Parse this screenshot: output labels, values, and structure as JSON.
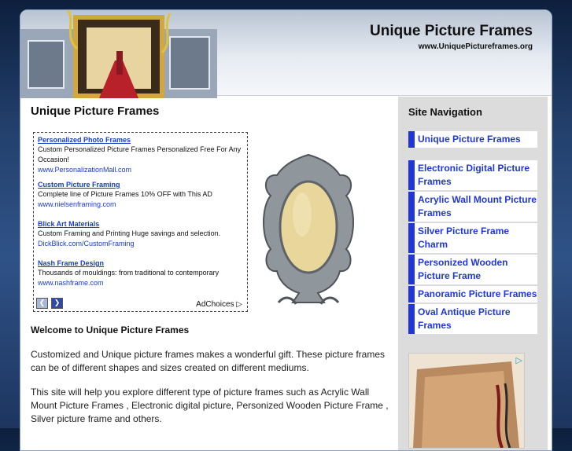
{
  "header": {
    "title": "Unique Picture Frames",
    "url": "www.UniquePictureframes.org"
  },
  "main": {
    "title": "Unique Picture Frames",
    "ads": [
      {
        "title": "Personalized Photo Frames",
        "desc": "Custom Personalized Picture Frames Personalized Free For Any Occasion!",
        "link": "www.PersonalizationMall.com"
      },
      {
        "title": "Custom Picture Framing",
        "desc": "Complete line of Picture Frames 10% OFF with This AD",
        "link": "www.nielsenframing.com"
      },
      {
        "title": "Blick Art Materials",
        "desc": "Custom Framing and Printing Huge savings and selection.",
        "link": "DickBlick.com/CustomFraming"
      },
      {
        "title": "Nash Frame Design",
        "desc": "Thousands of mouldings: from traditional to contemporary",
        "link": "www.nashframe.com"
      }
    ],
    "adchoices": "AdChoices",
    "welcome": "Welcome to Unique Picture Frames",
    "para1": "Customized and Unique picture frames makes a wonderful gift. These picture frames can be of different shapes and sizes created on different mediums.",
    "para2": "This site will help you explore different type of picture frames such as Acrylic Wall Mount Picture Frames , Electronic digital picture, Personized Wooden Picture Frame , Silver picture frame and others."
  },
  "sidebar": {
    "title": "Site Navigation",
    "home": "Unique Picture Frames",
    "items": [
      "Electronic Digital Picture Frames",
      "Acrylic Wall Mount Picture Frames",
      "Silver Picture Frame Charm",
      "Personized Wooden Picture Frame",
      "Panoramic Picture Frames",
      "Oval Antique Picture Frames"
    ]
  },
  "colors": {
    "nav_accent": "#1f37d6",
    "link": "#1a3fbd",
    "background": "#23406d"
  }
}
